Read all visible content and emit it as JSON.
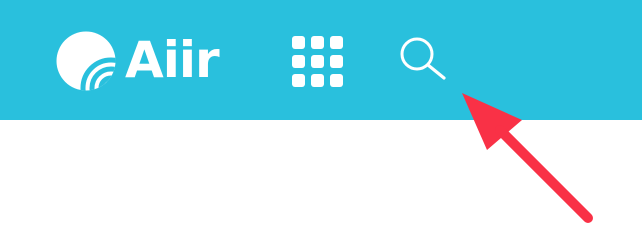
{
  "header": {
    "background_color": "#29c0dd",
    "logo": {
      "text": "Aiir",
      "icon": "wifi-signal-logo-icon",
      "color": "#ffffff"
    },
    "apps_button": {
      "icon": "grid-apps-icon"
    },
    "search_button": {
      "icon": "search-icon"
    }
  },
  "annotation": {
    "type": "arrow",
    "color": "#f93146",
    "points_to": "search-button"
  }
}
